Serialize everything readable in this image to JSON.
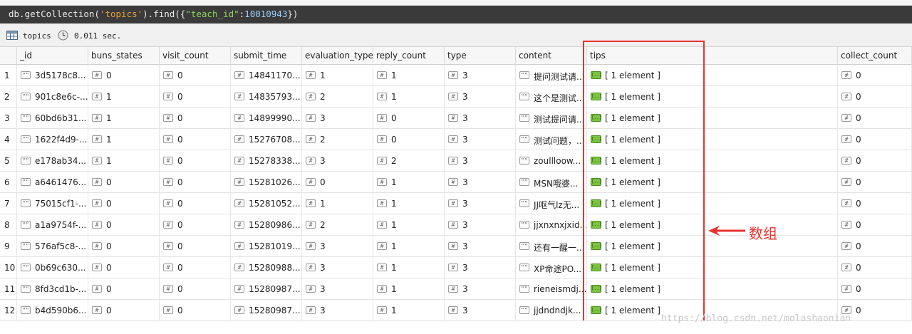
{
  "query": {
    "parts": [
      {
        "text": "db.getCollection(",
        "kind": "plain"
      },
      {
        "text": "'topics'",
        "kind": "str"
      },
      {
        "text": ").find({",
        "kind": "plain"
      },
      {
        "text": "\"teach_id\"",
        "kind": "key"
      },
      {
        "text": ":",
        "kind": "punc"
      },
      {
        "text": "10010943",
        "kind": "num"
      },
      {
        "text": "})",
        "kind": "plain"
      }
    ]
  },
  "info": {
    "collection": "topics",
    "duration": "0.011 sec."
  },
  "grid": {
    "columns": [
      "_id",
      "buns_states",
      "visit_count",
      "submit_time",
      "evaluation_type",
      "reply_count",
      "type",
      "content",
      "tips",
      "collect_count"
    ],
    "rows": [
      {
        "n": "1",
        "_id": "3d5178c8...",
        "buns_states": "0",
        "visit_count": "0",
        "submit_time": "14841170...",
        "evaluation_type": "1",
        "reply_count": "1",
        "type": "3",
        "content": "提问测试请...",
        "tips": "[ 1 element ]",
        "collect_count": "0"
      },
      {
        "n": "2",
        "_id": "901c8e6c-...",
        "buns_states": "1",
        "visit_count": "0",
        "submit_time": "14835793...",
        "evaluation_type": "2",
        "reply_count": "1",
        "type": "3",
        "content": "这个是测试...",
        "tips": "[ 1 element ]",
        "collect_count": "0"
      },
      {
        "n": "3",
        "_id": "60bd6b31...",
        "buns_states": "1",
        "visit_count": "0",
        "submit_time": "14899990...",
        "evaluation_type": "3",
        "reply_count": "0",
        "type": "3",
        "content": "测试提问请...",
        "tips": "[ 1 element ]",
        "collect_count": "0"
      },
      {
        "n": "4",
        "_id": "1622f4d9-...",
        "buns_states": "1",
        "visit_count": "0",
        "submit_time": "15276708...",
        "evaluation_type": "2",
        "reply_count": "0",
        "type": "3",
        "content": "测试问题，...",
        "tips": "[ 1 element ]",
        "collect_count": "0"
      },
      {
        "n": "5",
        "_id": "e178ab34...",
        "buns_states": "1",
        "visit_count": "0",
        "submit_time": "15278338...",
        "evaluation_type": "3",
        "reply_count": "2",
        "type": "3",
        "content": "zoullloow...",
        "tips": "[ 1 element ]",
        "collect_count": "0"
      },
      {
        "n": "6",
        "_id": "a6461476...",
        "buns_states": "0",
        "visit_count": "0",
        "submit_time": "15281026...",
        "evaluation_type": "0",
        "reply_count": "1",
        "type": "3",
        "content": "MSN哦婆...",
        "tips": "[ 1 element ]",
        "collect_count": "0"
      },
      {
        "n": "7",
        "_id": "75015cf1-...",
        "buns_states": "0",
        "visit_count": "0",
        "submit_time": "15281052...",
        "evaluation_type": "1",
        "reply_count": "1",
        "type": "3",
        "content": "JJ呕气lz无...",
        "tips": "[ 1 element ]",
        "collect_count": "0"
      },
      {
        "n": "8",
        "_id": "a1a9754f-...",
        "buns_states": "0",
        "visit_count": "0",
        "submit_time": "15280986...",
        "evaluation_type": "2",
        "reply_count": "1",
        "type": "3",
        "content": "jjxnxnxjxid...",
        "tips": "[ 1 element ]",
        "collect_count": "0"
      },
      {
        "n": "9",
        "_id": "576af5c8-...",
        "buns_states": "0",
        "visit_count": "0",
        "submit_time": "15281019...",
        "evaluation_type": "3",
        "reply_count": "1",
        "type": "3",
        "content": "还有一醒一...",
        "tips": "[ 1 element ]",
        "collect_count": "0"
      },
      {
        "n": "10",
        "_id": "0b69c630...",
        "buns_states": "0",
        "visit_count": "0",
        "submit_time": "15280988...",
        "evaluation_type": "3",
        "reply_count": "1",
        "type": "3",
        "content": "XP命途PO...",
        "tips": "[ 1 element ]",
        "collect_count": "0"
      },
      {
        "n": "11",
        "_id": "8fd3cd1b-...",
        "buns_states": "0",
        "visit_count": "0",
        "submit_time": "15280987...",
        "evaluation_type": "3",
        "reply_count": "1",
        "type": "3",
        "content": "rieneismdj...",
        "tips": "[ 1 element ]",
        "collect_count": "0"
      },
      {
        "n": "12",
        "_id": "b4d590b6...",
        "buns_states": "0",
        "visit_count": "0",
        "submit_time": "15280987...",
        "evaluation_type": "3",
        "reply_count": "1",
        "type": "3",
        "content": "jjdndndjk...",
        "tips": "[ 1 element ]",
        "collect_count": "0"
      }
    ]
  },
  "annotation": {
    "label": "数组",
    "color": "#e8332f"
  },
  "watermark": "https://blog.csdn.net/molashaonian",
  "colors": {
    "querybar_bg": "#3a3a3a",
    "array_badge": "#7dc242",
    "annotation": "#e8332f"
  },
  "icons": {
    "collection": "table-icon",
    "timer": "clock-icon",
    "string_type": "string-type-icon",
    "int_type": "int32-type-icon",
    "array_type": "array-type-icon"
  }
}
